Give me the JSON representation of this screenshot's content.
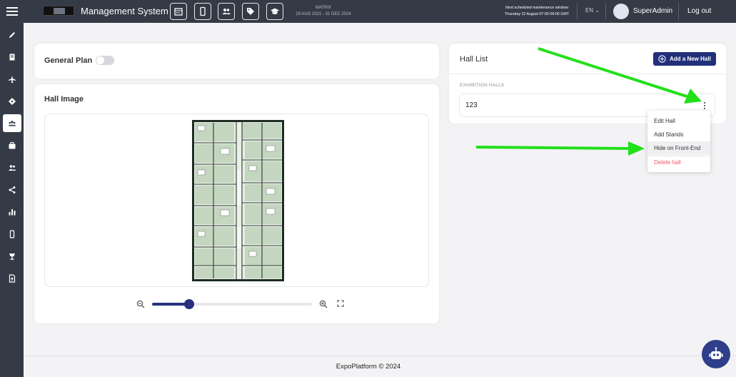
{
  "header": {
    "app_title": "Management System",
    "event": {
      "name": "MATRIX",
      "dates": "19 AUG 2021 - 31 DEC 2024"
    },
    "maintenance": {
      "line1": "Next scheduled maintenance window:",
      "line2": "Thursday 22 August 07:00-09:00 GMT"
    },
    "language": "EN",
    "user_name": "SuperAdmin",
    "logout_label": "Log out",
    "toolbar_icons": [
      "calendar-icon",
      "mobile-icon",
      "users-icon",
      "tag-icon",
      "graduation-cap-icon"
    ]
  },
  "sidebar": {
    "items": [
      {
        "icon": "pencil-icon",
        "active": false
      },
      {
        "icon": "book-icon",
        "active": false
      },
      {
        "icon": "plane-icon",
        "active": false
      },
      {
        "icon": "ticket-icon",
        "active": false
      },
      {
        "icon": "group-icon",
        "active": true
      },
      {
        "icon": "briefcase-icon",
        "active": false
      },
      {
        "icon": "people-icon",
        "active": false
      },
      {
        "icon": "share-icon",
        "active": false
      },
      {
        "icon": "bar-chart-icon",
        "active": false
      },
      {
        "icon": "mobile-icon",
        "active": false
      },
      {
        "icon": "lamp-icon",
        "active": false
      },
      {
        "icon": "file-upload-icon",
        "active": false
      }
    ]
  },
  "general_plan": {
    "label": "General Plan",
    "enabled": false
  },
  "hall_image": {
    "title": "Hall Image",
    "zoom_level_fraction": 0.23
  },
  "hall_list": {
    "title": "Hall List",
    "add_button_label": "Add a New Hall",
    "section_label": "EXHIBITION HALLS",
    "halls": [
      {
        "name": "123"
      }
    ]
  },
  "context_menu": {
    "items": [
      {
        "label": "Edit Hall",
        "hover": false,
        "danger": false
      },
      {
        "label": "Add Stands",
        "hover": false,
        "danger": false
      },
      {
        "label": "Hide on Front-End",
        "hover": true,
        "danger": false
      },
      {
        "label": "Delete hall",
        "hover": false,
        "danger": true
      }
    ]
  },
  "footer": {
    "text": "ExpoPlatform © 2024"
  },
  "colors": {
    "topbar": "#343a46",
    "primary": "#22307a",
    "danger": "#f05a6a",
    "arrow": "#22e01a"
  }
}
